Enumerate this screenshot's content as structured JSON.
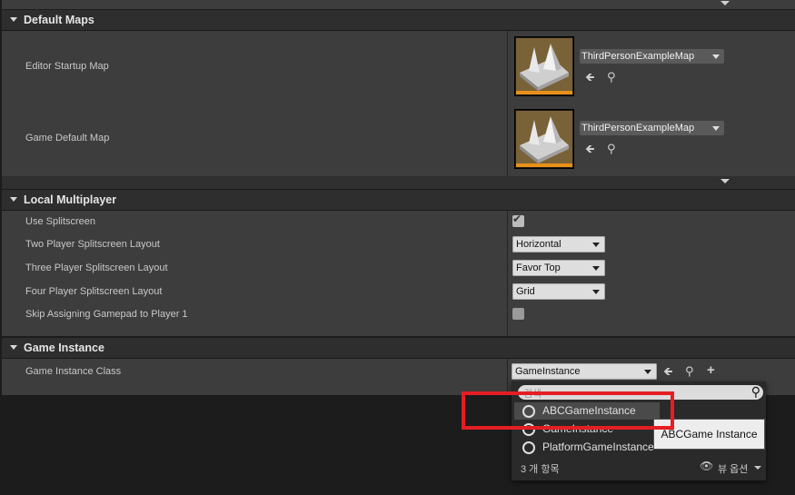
{
  "default_maps": {
    "title": "Default Maps",
    "editor_startup_label": "Editor Startup Map",
    "editor_startup_value": "ThirdPersonExampleMap",
    "game_default_label": "Game Default Map",
    "game_default_value": "ThirdPersonExampleMap"
  },
  "local_multiplayer": {
    "title": "Local Multiplayer",
    "rows": [
      {
        "label": "Use Splitscreen"
      },
      {
        "label": "Two Player Splitscreen Layout",
        "value": "Horizontal"
      },
      {
        "label": "Three Player Splitscreen Layout",
        "value": "Favor Top"
      },
      {
        "label": "Four Player Splitscreen Layout",
        "value": "Grid"
      },
      {
        "label": "Skip Assigning Gamepad to Player 1"
      }
    ],
    "use_splitscreen_checked": true,
    "skip_gamepad_checked": false
  },
  "game_instance": {
    "title": "Game Instance",
    "class_label": "Game Instance Class",
    "class_value": "GameInstance"
  },
  "picker": {
    "search_placeholder": "검색",
    "items": [
      "ABCGameInstance",
      "GameInstance",
      "PlatformGameInstance"
    ],
    "count_text": "3 개 항목",
    "view_options": "뷰 옵션",
    "tooltip": "ABCGame Instance"
  }
}
